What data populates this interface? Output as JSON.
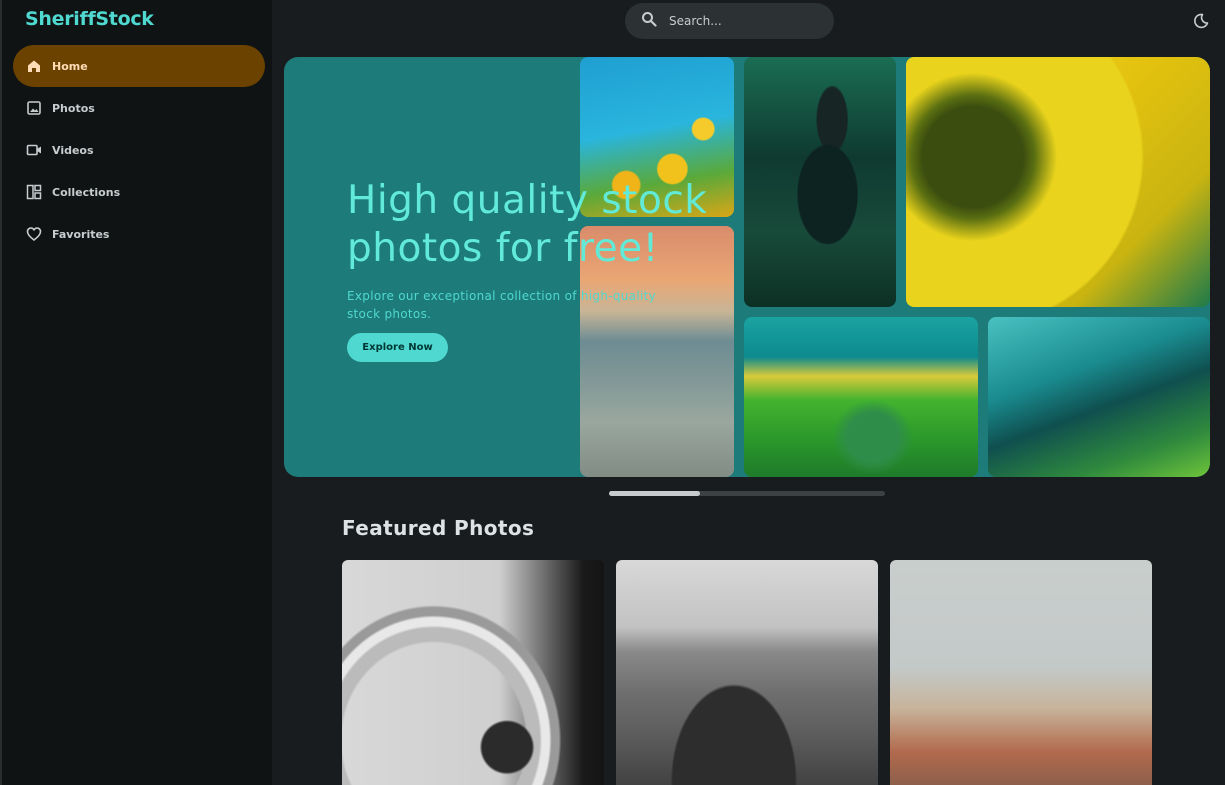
{
  "brand": "SheriffStock",
  "nav": [
    {
      "label": "Home",
      "icon": "home-icon",
      "active": true
    },
    {
      "label": "Photos",
      "icon": "image-icon",
      "active": false
    },
    {
      "label": "Videos",
      "icon": "video-icon",
      "active": false
    },
    {
      "label": "Collections",
      "icon": "collections-icon",
      "active": false
    },
    {
      "label": "Favorites",
      "icon": "heart-icon",
      "active": false
    }
  ],
  "search": {
    "placeholder": "Search..."
  },
  "hero": {
    "title": "High quality stock photos for free!",
    "subtitle": "Explore our exceptional collection of high-quality stock photos.",
    "button": "Explore Now"
  },
  "carousel": {
    "progress": 0.33
  },
  "featured": {
    "title": "Featured Photos"
  },
  "colors": {
    "accent": "#4fd8cf",
    "active_nav": "#6b4200",
    "hero_bg": "#1d7b7a",
    "background": "#191c1e"
  }
}
